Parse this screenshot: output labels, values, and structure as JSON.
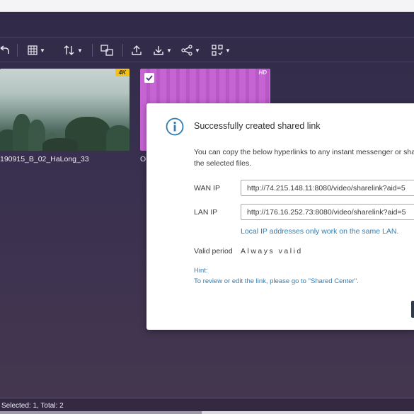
{
  "toolbar": {
    "icons": [
      "back-icon",
      "grid-view-icon",
      "sort-icon",
      "convert-icon",
      "upload-icon",
      "download-icon",
      "share-icon",
      "multi-select-icon"
    ]
  },
  "files": [
    {
      "name": "190915_B_02_HaLong_33",
      "badge": "4K",
      "selected": false
    },
    {
      "name": "O",
      "badge": "HD",
      "selected": true
    }
  ],
  "status": {
    "text": "Selected: 1, Total: 2"
  },
  "dialog": {
    "title": "Successfully created shared link",
    "description": "You can copy the below hyperlinks to any instant messenger or share the selected files.",
    "wan": {
      "label": "WAN IP",
      "value": "http://74.215.148.11:8080/video/sharelink?aid=5"
    },
    "lan": {
      "label": "LAN IP",
      "value": "http://176.16.252.73:8080/video/sharelink?aid=5"
    },
    "lan_note": "Local IP addresses only work on the same LAN.",
    "valid_period": {
      "label": "Valid period",
      "value": "Always valid"
    },
    "hint_label": "Hint:",
    "hint_text": "To review or edit the link, please go to \"Shared Center\".",
    "colors": {
      "link": "#2f7db4",
      "info_icon": "#2f7db4"
    }
  },
  "colors": {
    "badge_4k": "#f2c21b",
    "selected_video": "#c764d4"
  }
}
